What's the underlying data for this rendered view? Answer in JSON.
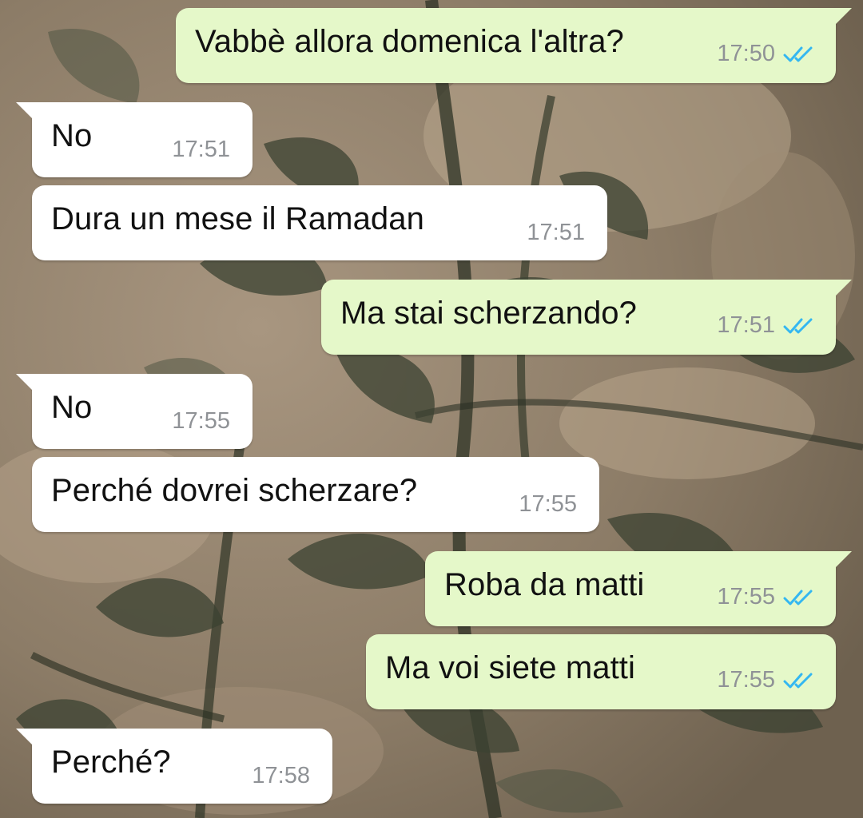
{
  "colors": {
    "outgoing_bubble": "#e5f8c9",
    "incoming_bubble": "#ffffff",
    "read_ticks": "#34b7f1",
    "timestamp": "#8f9296"
  },
  "messages": [
    {
      "direction": "out",
      "text": "Vabbè allora domenica l'altra?",
      "time": "17:50",
      "status_icon": "double-check-read-icon"
    },
    {
      "direction": "in",
      "text": "No",
      "time": "17:51"
    },
    {
      "direction": "in",
      "text": "Dura un mese il Ramadan",
      "time": "17:51"
    },
    {
      "direction": "out",
      "text": "Ma stai scherzando?",
      "time": "17:51",
      "status_icon": "double-check-read-icon"
    },
    {
      "direction": "in",
      "text": "No",
      "time": "17:55"
    },
    {
      "direction": "in",
      "text": "Perché dovrei scherzare?",
      "time": "17:55"
    },
    {
      "direction": "out",
      "text": "Roba da matti",
      "time": "17:55",
      "status_icon": "double-check-read-icon"
    },
    {
      "direction": "out",
      "text": "Ma voi siete matti",
      "time": "17:55",
      "status_icon": "double-check-read-icon"
    },
    {
      "direction": "in",
      "text": "Perché?",
      "time": "17:58"
    }
  ]
}
